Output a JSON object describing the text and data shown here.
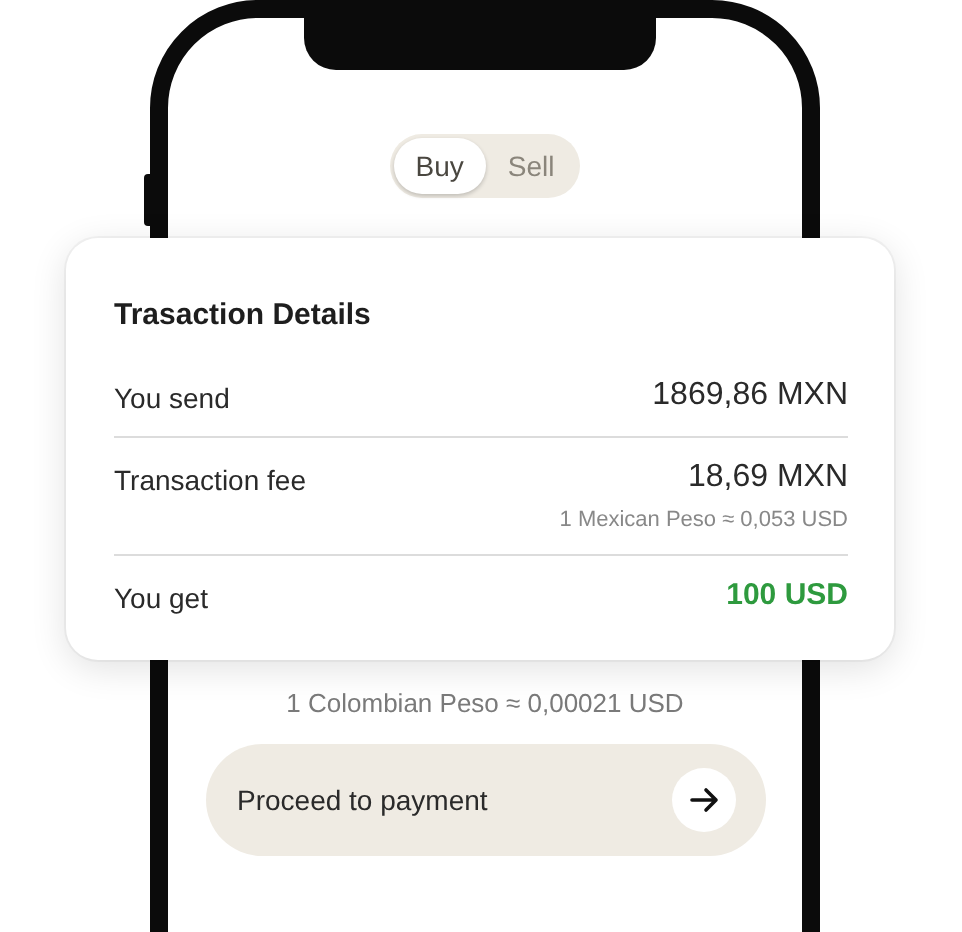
{
  "toggle": {
    "options": [
      {
        "label": "Buy",
        "selected": true
      },
      {
        "label": "Sell",
        "selected": false
      }
    ]
  },
  "details": {
    "title": "Trasaction Details",
    "rows": [
      {
        "label": "You send",
        "value": "1869,86 MXN",
        "highlight": false
      },
      {
        "label": "Transaction fee",
        "value": "18,69 MXN",
        "note": "1 Mexican Peso ≈ 0,053 USD",
        "highlight": false
      },
      {
        "label": "You get",
        "value": "100 USD",
        "highlight": true
      }
    ]
  },
  "rate": "1 Colombian Peso ≈ 0,00021 USD",
  "proceed_button": {
    "label": "Proceed to payment"
  }
}
